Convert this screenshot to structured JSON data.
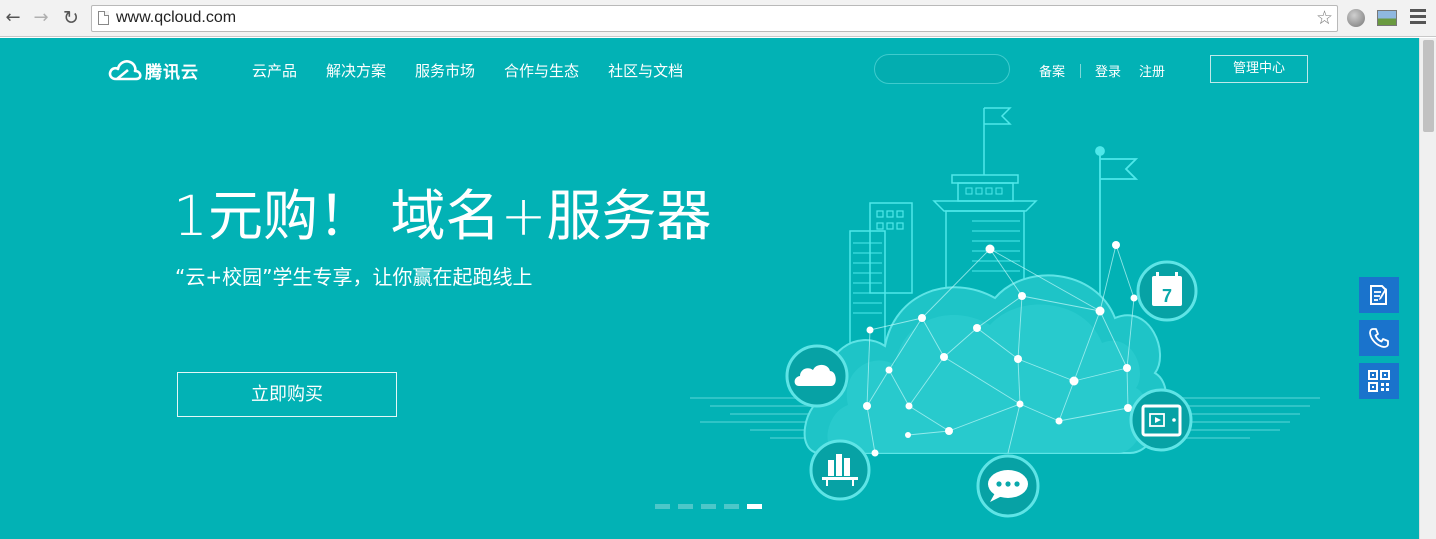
{
  "browser": {
    "url": "www.qcloud.com",
    "icons": {
      "back": "back-arrow-icon",
      "forward": "forward-arrow-icon",
      "reload": "reload-icon",
      "page": "page-icon",
      "bookmark": "star-icon",
      "extension1": "globe-icon",
      "extension2": "image-icon",
      "menu": "hamburger-menu-icon"
    }
  },
  "header": {
    "logo_text": "腾讯云",
    "nav": [
      {
        "label": "云产品"
      },
      {
        "label": "解决方案"
      },
      {
        "label": "服务市场"
      },
      {
        "label": "合作与生态"
      },
      {
        "label": "社区与文档"
      }
    ],
    "search_placeholder": "",
    "links": {
      "beian": "备案",
      "login": "登录",
      "register": "注册"
    },
    "console_button": "管理中心"
  },
  "hero": {
    "headline": "1元购！ 域名+服务器",
    "subhead": "“云+校园”学生专享，让你赢在起跑线上",
    "cta": "立即购买",
    "illustration_icons": [
      "cloud-icon",
      "calendar-icon",
      "video-icon",
      "chat-icon",
      "books-icon"
    ],
    "carousel": {
      "total": 5,
      "active": 5
    }
  },
  "side_tools": [
    {
      "icon": "edit-note-icon"
    },
    {
      "icon": "phone-icon"
    },
    {
      "icon": "qr-code-icon"
    }
  ],
  "colors": {
    "hero_bg": "#02b2b5",
    "side_tool_bg": "#1a73cc",
    "chrome_bg": "#f2f2f2"
  }
}
